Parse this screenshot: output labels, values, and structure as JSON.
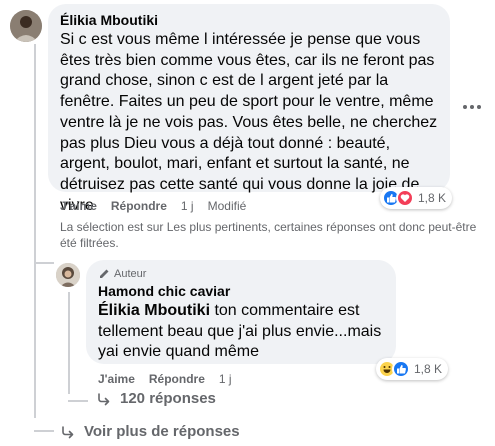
{
  "comment": {
    "author": "Élikia Mboutiki",
    "text": "Si c est vous même l intéressée je pense que vous êtes très bien comme vous êtes, car ils ne feront pas grand chose, sinon c est de l argent jeté par la fenêtre. Faites un peu de sport pour le ventre, même ventre là je ne vois pas. Vous êtes belle, ne cherchez pas plus Dieu vous a déjà tout donné : beauté, argent, boulot, mari, enfant et surtout la santé, ne détruisez pas cette santé qui vous donne la joie de vivre",
    "like_label": "J'aime",
    "reply_label": "Répondre",
    "time": "1 j",
    "edited_label": "Modifié",
    "reaction_count": "1,8 K",
    "reactions": [
      "like",
      "love"
    ]
  },
  "filter_notice": "La sélection est sur Les plus pertinents, certaines réponses ont donc peut-être été filtrées.",
  "reply": {
    "badge": "Auteur",
    "author": "Hamond chic caviar",
    "mention": "Élikia Mboutiki",
    "text": " ton commentaire est tellement beau que j'ai plus envie...mais yai envie quand même",
    "like_label": "J'aime",
    "reply_label": "Répondre",
    "time": "1 j",
    "reaction_count": "1,8 K",
    "reactions": [
      "haha",
      "like"
    ]
  },
  "view_replies": "120 réponses",
  "view_more": "Voir plus de réponses",
  "colors": {
    "bubble": "#f0f2f5",
    "like_blue": "#1877f2",
    "love_red": "#f33e58",
    "haha_yellow": "#fcd34d",
    "secondary_text": "#65676b"
  }
}
